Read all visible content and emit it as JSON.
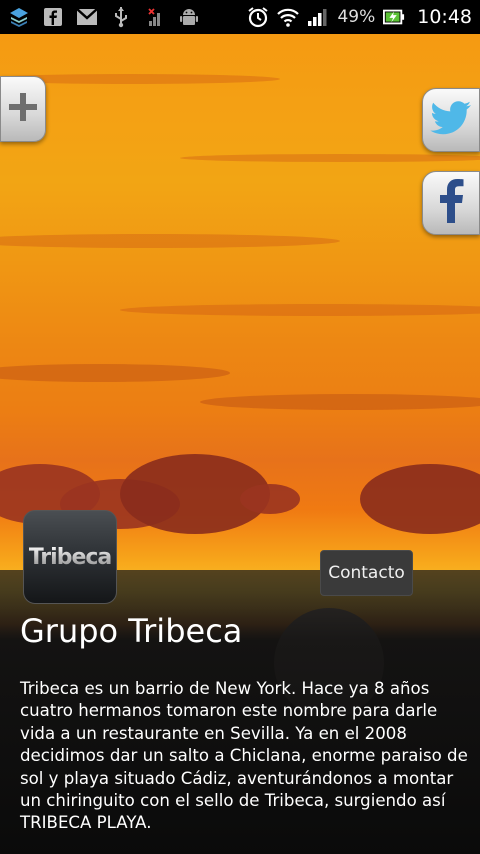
{
  "status_bar": {
    "icons_left": [
      "stack-icon",
      "facebook-icon",
      "gmail-icon",
      "usb-icon",
      "signal-off-icon",
      "android-icon"
    ],
    "battery_percent": "49%",
    "time": "10:48"
  },
  "side_buttons": {
    "left": "plus-icon",
    "right": [
      "twitter-icon",
      "facebook-icon"
    ]
  },
  "logo": {
    "text": "Tribeca"
  },
  "contact_button": "Contacto",
  "title": "Grupo Tribeca",
  "description": "Tribeca es un barrio de New York. Hace ya 8 años cuatro hermanos tomaron este nombre para darle vida a un restaurante en Sevilla. Ya en el 2008 decidimos dar un salto a Chiclana, enorme paraiso de sol y playa situado Cádiz, aventurándonos a montar un chiringuito con el sello de Tribeca, surgiendo así TRIBECA PLAYA.",
  "colors": {
    "twitter": "#4fb8e8",
    "facebook": "#2d4e8a",
    "battery_green": "#5bc236"
  }
}
